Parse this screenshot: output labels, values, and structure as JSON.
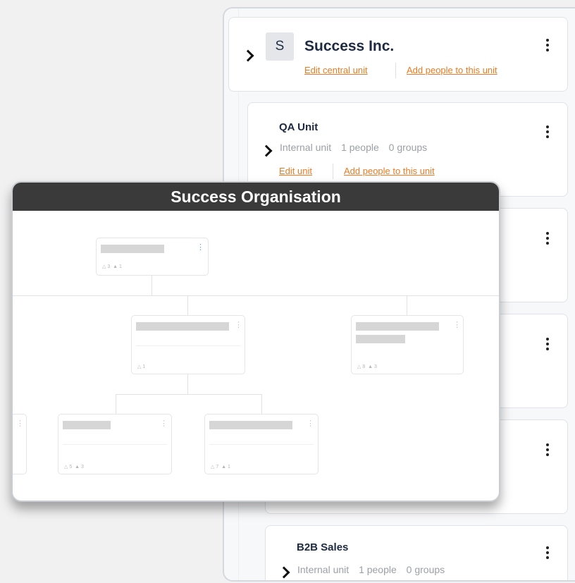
{
  "central_unit": {
    "avatar_letter": "S",
    "name": "Success Inc.",
    "edit_link": "Edit central unit",
    "add_people_link": "Add people to this unit"
  },
  "qa_unit": {
    "name": "QA Unit",
    "type": "Internal unit",
    "people": "1 people",
    "groups": "0 groups",
    "edit_link": "Edit unit",
    "add_people_link": "Add people to this unit"
  },
  "b2b_sales": {
    "name": "B2B Sales",
    "type": "Internal unit",
    "people": "1 people",
    "groups": "0 groups"
  },
  "org_chart": {
    "title": "Success Organisation",
    "nodes": [
      {
        "stat_people": "3",
        "stat_groups": "1"
      },
      {
        "stat_people": "1"
      },
      {
        "stat_people": "8",
        "stat_groups": "3"
      },
      {
        "stat_people": "5",
        "stat_groups": "3"
      },
      {
        "stat_people": "7",
        "stat_groups": "1"
      }
    ]
  },
  "colors": {
    "link": "#ec7a22",
    "title": "#1d2a42",
    "org_header": "#3a3a3a"
  }
}
